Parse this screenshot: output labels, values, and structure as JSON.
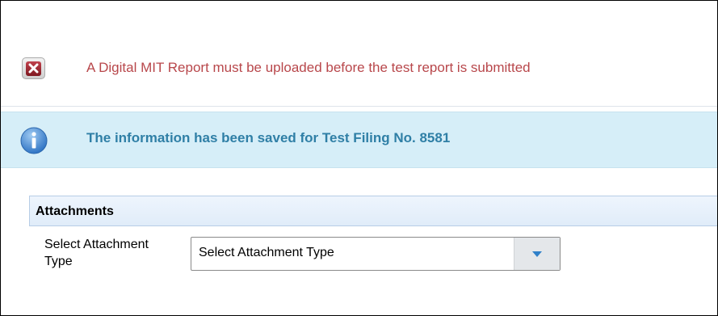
{
  "error_message": {
    "text": "A Digital MIT Report must be uploaded before the test report is submitted",
    "icon": "error-x-icon",
    "color": "#b8474b"
  },
  "info_message": {
    "text": "The information has been saved for Test Filing No. 8581",
    "icon": "info-icon",
    "color": "#2f7fa6",
    "background": "#d6eef8"
  },
  "attachments": {
    "title": "Attachments",
    "select_label": "Select Attachment Type",
    "select_value": "Select Attachment Type"
  }
}
